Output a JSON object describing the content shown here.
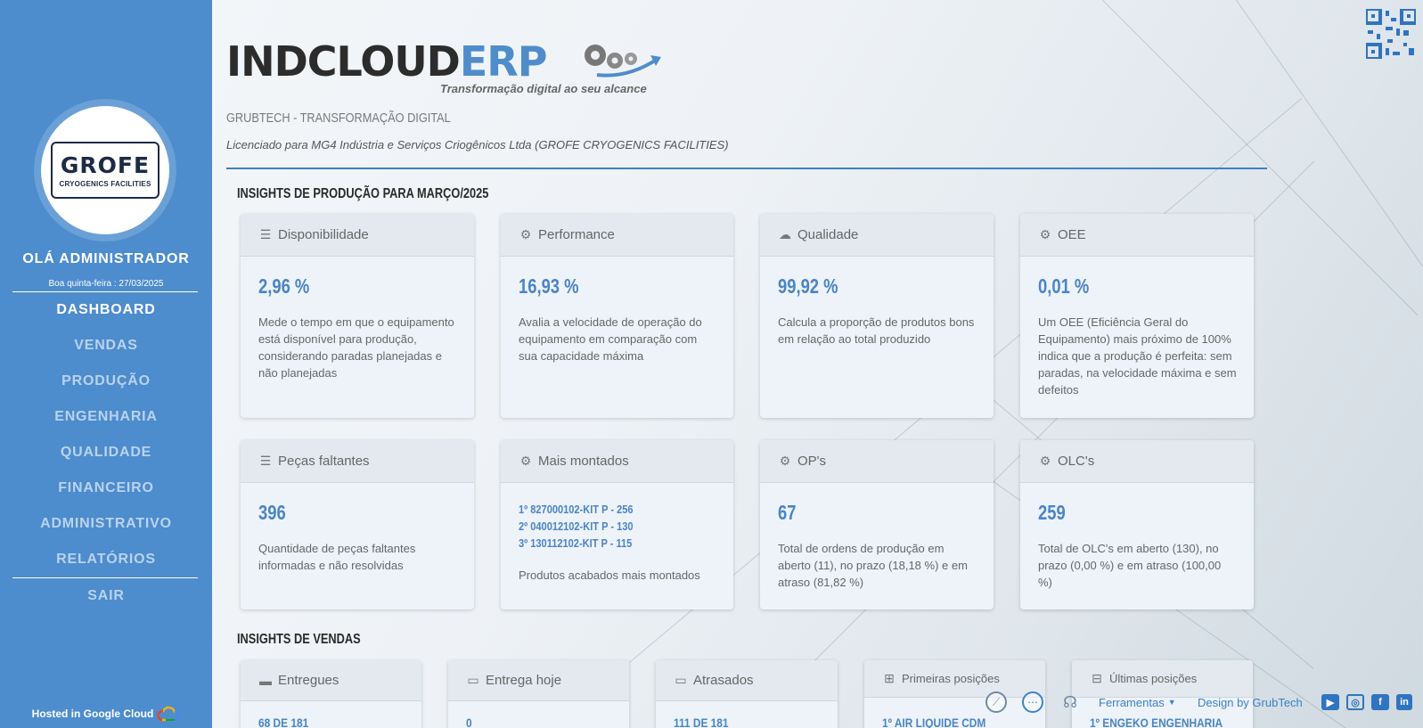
{
  "brand": {
    "part1": "INDCLOUD",
    "part2": "ERP",
    "tagline": "Transformação digital ao seu alcance"
  },
  "header": {
    "company": "GRUBTECH - TRANSFORMAÇÃO DIGITAL",
    "license": "Licenciado para MG4 Indústria e Serviços Criogênicos Ltda (GROFE CRYOGENICS FACILITIES)"
  },
  "sidebar": {
    "logo_big": "GROFE",
    "logo_small": "CRYOGENICS FACILITIES",
    "greeting": "OLÁ ADMINISTRADOR",
    "date": "Boa quinta-feira : 27/03/2025",
    "items": [
      {
        "label": "DASHBOARD"
      },
      {
        "label": "VENDAS"
      },
      {
        "label": "PRODUÇÃO"
      },
      {
        "label": "ENGENHARIA"
      },
      {
        "label": "QUALIDADE"
      },
      {
        "label": "FINANCEIRO"
      },
      {
        "label": "ADMINISTRATIVO"
      },
      {
        "label": "RELATÓRIOS"
      },
      {
        "label": "SAIR"
      }
    ],
    "hosted": "Hosted in Google Cloud"
  },
  "production": {
    "title": "INSIGHTS DE PRODUÇÃO PARA MARÇO/2025",
    "cards": [
      {
        "title": "Disponibilidade",
        "icon": "list-icon",
        "value": "2,96 %",
        "desc": "Mede o tempo em que o equipamento está disponível para produção, considerando paradas planejadas e não planejadas"
      },
      {
        "title": "Performance",
        "icon": "gears-icon",
        "value": "16,93 %",
        "desc": "Avalia a velocidade de operação do equipamento em comparação com sua capacidade máxima"
      },
      {
        "title": "Qualidade",
        "icon": "cloud-icon",
        "value": "99,92 %",
        "desc": "Calcula a proporção de produtos bons em relação ao total produzido"
      },
      {
        "title": "OEE",
        "icon": "gear-icon",
        "value": "0,01 %",
        "desc": "Um OEE (Eficiência Geral do Equipamento) mais próximo de 100% indica que a produção é perfeita: sem paradas, na velocidade máxima e sem defeitos"
      },
      {
        "title": "Peças faltantes",
        "icon": "list-icon",
        "value": "396",
        "desc": "Quantidade de peças faltantes informadas e não resolvidas"
      },
      {
        "title": "Mais montados",
        "icon": "gears-icon",
        "list": [
          "1º 827000102-KIT P - 256",
          "2º 040012102-KIT P - 130",
          "3º 130112102-KIT P - 115"
        ],
        "desc": "Produtos acabados mais montados"
      },
      {
        "title": "OP's",
        "icon": "gear-icon",
        "value": "67",
        "desc": "Total de ordens de produção em aberto (11), no prazo (18,18 %) e em atraso (81,82 %)"
      },
      {
        "title": "OLC's",
        "icon": "gears-icon",
        "value": "259",
        "desc": "Total de OLC's em aberto (130), no prazo (0,00 %) e em atraso (100,00 %)"
      }
    ]
  },
  "sales": {
    "title": "INSIGHTS DE VENDAS",
    "cards": [
      {
        "title": "Entregues",
        "icon": "battery-full-icon",
        "value": "68 DE 181"
      },
      {
        "title": "Entrega hoje",
        "icon": "battery-half-icon",
        "value": "0"
      },
      {
        "title": "Atrasados",
        "icon": "battery-empty-icon",
        "value": "111 DE 181"
      },
      {
        "title": "Primeiras posições",
        "icon": "plus-square-icon",
        "value": "1º AIR LIQUIDE CDM"
      },
      {
        "title": "Últimas posições",
        "icon": "minus-square-icon",
        "value": "1º ENGEKO ENGENHARIA"
      }
    ]
  },
  "bottombar": {
    "tools": "Ferramentas",
    "design": "Design by GrubTech",
    "social": [
      "YT",
      "IG",
      "f",
      "in"
    ]
  },
  "colors": {
    "sidebar": "#4d8ccd",
    "accent": "#4a84c4",
    "brand_dark": "#2c2c2c"
  }
}
